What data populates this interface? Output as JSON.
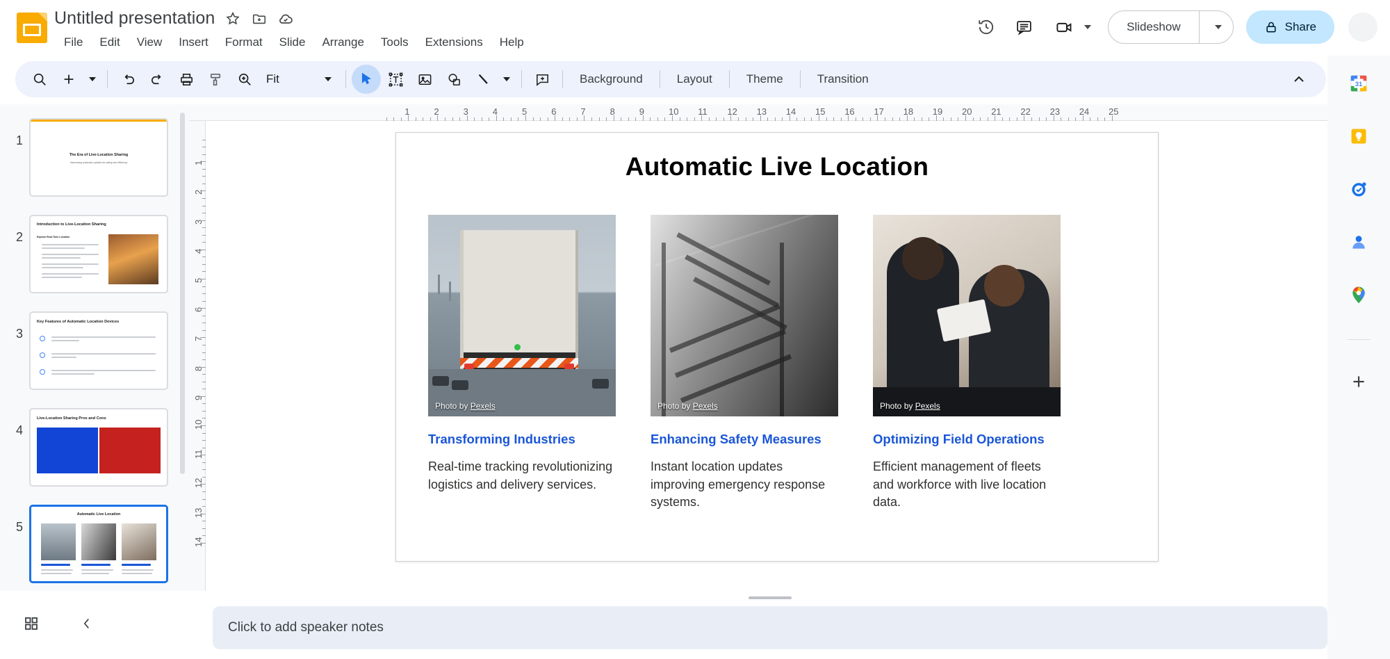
{
  "app": {
    "name": "Google Slides",
    "logo_color": "#f9ab00"
  },
  "header": {
    "doc_title": "Untitled presentation",
    "star_icon": "star-icon",
    "move_icon": "move-to-folder-icon",
    "cloud_icon": "cloud-saved-icon",
    "menus": [
      "File",
      "Edit",
      "View",
      "Insert",
      "Format",
      "Slide",
      "Arrange",
      "Tools",
      "Extensions",
      "Help"
    ],
    "history_icon": "version-history-icon",
    "comment_icon": "comment-icon",
    "meet_icon": "meet-camera-icon",
    "slideshow_label": "Slideshow",
    "slideshow_caret": "chevron-down-icon",
    "share_label": "Share",
    "share_lock_icon": "lock-icon",
    "share_bg": "#c2e7ff"
  },
  "toolbar": {
    "background": "#edf2fc",
    "search_icon": "search-icon",
    "add_icon": "new-slide-icon",
    "add_caret": "chevron-down-icon",
    "undo_icon": "undo-icon",
    "redo_icon": "redo-icon",
    "print_icon": "print-icon",
    "paint_icon": "paint-format-icon",
    "zoom_icon": "zoom-icon",
    "zoom_value": "Fit",
    "zoom_caret": "chevron-down-icon",
    "select_icon": "select-cursor-icon",
    "textbox_icon": "text-box-icon",
    "image_icon": "insert-image-icon",
    "shape_icon": "shape-icon",
    "line_icon": "line-icon",
    "line_caret": "chevron-down-icon",
    "comment_add_icon": "add-comment-icon",
    "background_label": "Background",
    "layout_label": "Layout",
    "theme_label": "Theme",
    "transition_label": "Transition",
    "collapse_icon": "chevron-up-icon"
  },
  "filmstrip": {
    "slides": [
      {
        "number": "1",
        "title": "The Era of Live-Location Sharing",
        "subtitle": "Harnessing automatic updates for safety and efficiency",
        "selected": false
      },
      {
        "number": "2",
        "title": "Introduction to Live-Location Sharing",
        "subtitle": "Explore Real-Time Location",
        "selected": false
      },
      {
        "number": "3",
        "title": "Key Features of Automatic Location Devices",
        "subtitle": "",
        "selected": false
      },
      {
        "number": "4",
        "title": "Live-Location Sharing Pros and Cons",
        "subtitle": "",
        "selected": false
      },
      {
        "number": "5",
        "title": "Automatic Live Location",
        "subtitle": "",
        "selected": true
      }
    ]
  },
  "rulers": {
    "horizontal_ticks": [
      "1",
      "2",
      "3",
      "4",
      "5",
      "6",
      "7",
      "8",
      "9",
      "10",
      "11",
      "12",
      "13",
      "14",
      "15",
      "16",
      "17",
      "18",
      "19",
      "20",
      "21",
      "22",
      "23",
      "24",
      "25"
    ],
    "vertical_ticks": [
      "1",
      "2",
      "3",
      "4",
      "5",
      "6",
      "7",
      "8",
      "9",
      "10",
      "11",
      "12",
      "13",
      "14"
    ]
  },
  "slide": {
    "title": "Automatic Live Location",
    "heading_color": "#1a56d6",
    "cards": [
      {
        "heading": "Transforming Industries",
        "body": "Real-time tracking revolutionizing logistics and delivery services.",
        "credit_prefix": "Photo by ",
        "credit_link": "Pexels",
        "image_alt": "semi-truck-on-highway"
      },
      {
        "heading": "Enhancing Safety Measures",
        "body": "Instant location updates improving emergency response systems.",
        "credit_prefix": "Photo by ",
        "credit_link": "Pexels",
        "image_alt": "fire-escape-stairs-black-and-white"
      },
      {
        "heading": "Optimizing Field Operations",
        "body": "Efficient management of fleets and workforce with live location data.",
        "credit_prefix": "Photo by ",
        "credit_link": "Pexels",
        "image_alt": "two-women-working-with-tablet"
      }
    ]
  },
  "notes": {
    "placeholder": "Click to add speaker notes"
  },
  "bottom": {
    "grid_view_icon": "grid-view-icon",
    "collapse_filmstrip_icon": "chevron-left-icon"
  },
  "rail": {
    "items": [
      {
        "icon": "google-calendar-icon",
        "label": "Calendar",
        "badge": "31"
      },
      {
        "icon": "google-keep-icon",
        "label": "Keep"
      },
      {
        "icon": "google-tasks-icon",
        "label": "Tasks"
      },
      {
        "icon": "google-contacts-icon",
        "label": "Contacts"
      },
      {
        "icon": "google-maps-icon",
        "label": "Maps"
      },
      {
        "icon": "add-apps-icon",
        "label": "Get Add-ons"
      }
    ]
  }
}
